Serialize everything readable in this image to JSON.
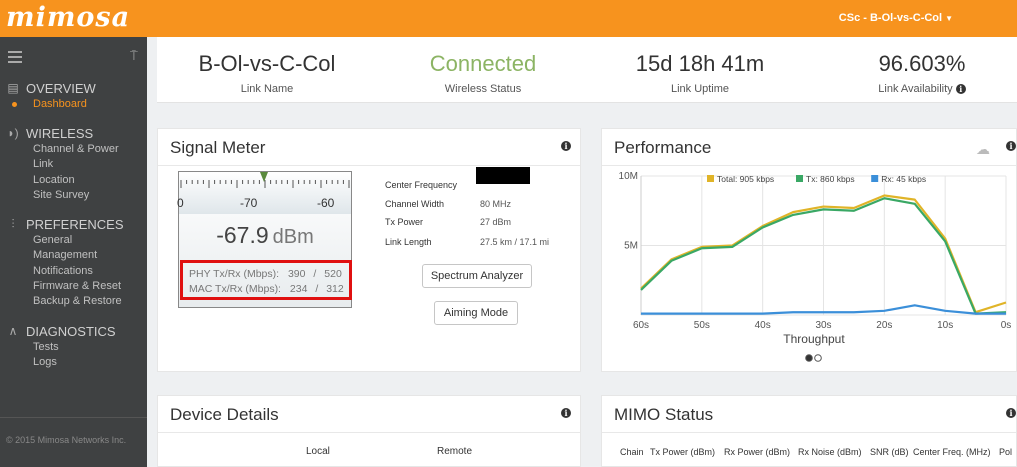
{
  "app": {
    "logo": "mimosa",
    "device_selector": "CSc - B-Ol-vs-C-Col"
  },
  "sidebar": {
    "sections": [
      {
        "title": "OVERVIEW",
        "icon": "list-icon",
        "items": [
          "Dashboard"
        ]
      },
      {
        "title": "WIRELESS",
        "icon": "signal-icon",
        "items": [
          "Channel & Power",
          "Link",
          "Location",
          "Site Survey"
        ]
      },
      {
        "title": "PREFERENCES",
        "icon": "sliders-icon",
        "items": [
          "General",
          "Management",
          "Notifications",
          "Firmware & Reset",
          "Backup & Restore"
        ]
      },
      {
        "title": "DIAGNOSTICS",
        "icon": "pulse-icon",
        "items": [
          "Tests",
          "Logs"
        ]
      }
    ],
    "active_item": "Dashboard",
    "copyright": "© 2015 Mimosa Networks Inc."
  },
  "stats": {
    "link_name": {
      "value": "B-Ol-vs-C-Col",
      "label": "Link Name"
    },
    "wireless_status": {
      "value": "Connected",
      "label": "Wireless Status"
    },
    "link_uptime": {
      "value": "15d 18h 41m",
      "label": "Link Uptime"
    },
    "link_availability": {
      "value": "96.603%",
      "label": "Link Availability"
    }
  },
  "signal_meter": {
    "title": "Signal Meter",
    "scale": [
      "0",
      "-70",
      "-60"
    ],
    "reading": "-67.9",
    "unit": "dBm",
    "phy_label": "PHY Tx/Rx (Mbps):",
    "phy_tx": "390",
    "phy_rx": "520",
    "mac_label": "MAC Tx/Rx (Mbps):",
    "mac_tx": "234",
    "mac_rx": "312",
    "sep": "/",
    "fields": {
      "center_frequency": {
        "label": "Center Frequency",
        "value": ""
      },
      "channel_width": {
        "label": "Channel Width",
        "value": "80 MHz"
      },
      "tx_power": {
        "label": "Tx Power",
        "value": "27 dBm"
      },
      "link_length": {
        "label": "Link Length",
        "value": "27.5 km / 17.1 mi"
      }
    },
    "buttons": {
      "spectrum": "Spectrum Analyzer",
      "aiming": "Aiming Mode"
    }
  },
  "performance": {
    "title": "Performance",
    "pager": [
      "active",
      "inactive"
    ]
  },
  "chart_data": {
    "type": "line",
    "xlabel": "Throughput",
    "x": [
      60,
      55,
      50,
      45,
      40,
      35,
      30,
      25,
      20,
      15,
      10,
      5,
      0
    ],
    "x_tick_labels": [
      "60s",
      "50s",
      "40s",
      "30s",
      "20s",
      "10s",
      "0s"
    ],
    "x_tick_values": [
      60,
      50,
      40,
      30,
      20,
      10,
      0
    ],
    "y_tick_labels": [
      "10M",
      "5M",
      ""
    ],
    "y_tick_values": [
      10,
      5,
      0
    ],
    "ylim": [
      0,
      10
    ],
    "grid": true,
    "legend_position": "top",
    "series": [
      {
        "name": "Total: 905 kbps",
        "color": "#e0b428",
        "values": [
          1.9,
          4.0,
          4.9,
          5.0,
          6.4,
          7.4,
          7.8,
          7.7,
          8.6,
          8.3,
          5.5,
          0.2,
          0.9
        ]
      },
      {
        "name": "Tx: 860 kbps",
        "color": "#3aa865",
        "values": [
          1.8,
          3.9,
          4.8,
          4.9,
          6.3,
          7.2,
          7.6,
          7.5,
          8.4,
          8.0,
          5.3,
          0.1,
          0.2
        ]
      },
      {
        "name": "Rx: 45 kbps",
        "color": "#3b8fd9",
        "values": [
          0.1,
          0.1,
          0.1,
          0.1,
          0.1,
          0.2,
          0.2,
          0.2,
          0.3,
          0.7,
          0.3,
          0.1,
          0.1
        ]
      }
    ]
  },
  "device_details": {
    "title": "Device Details",
    "col_local": "Local",
    "col_remote": "Remote"
  },
  "mimo": {
    "title": "MIMO Status",
    "columns": [
      "Chain",
      "Tx Power (dBm)",
      "Rx Power (dBm)",
      "Rx Noise (dBm)",
      "SNR (dB)",
      "Center Freq. (MHz)",
      "Pol"
    ]
  }
}
